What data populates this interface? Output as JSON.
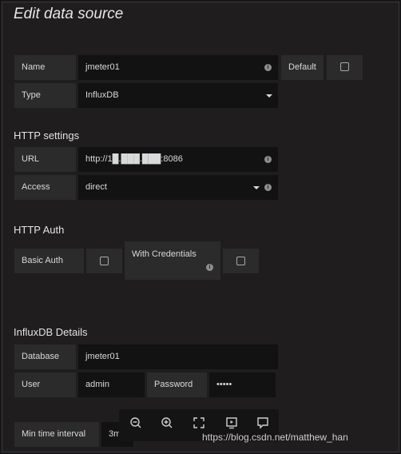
{
  "title": "Edit data source",
  "general": {
    "name_label": "Name",
    "name_value": "jmeter01",
    "default_label": "Default",
    "type_label": "Type",
    "type_value": "InfluxDB"
  },
  "http": {
    "heading": "HTTP settings",
    "url_label": "URL",
    "url_value": "http://1█.███.███:8086",
    "access_label": "Access",
    "access_value": "direct"
  },
  "auth": {
    "heading": "HTTP Auth",
    "basic_auth_label": "Basic Auth",
    "with_credentials_label": "With Credentials"
  },
  "influx": {
    "heading": "InfluxDB Details",
    "database_label": "Database",
    "database_value": "jmeter01",
    "user_label": "User",
    "user_value": "admin",
    "password_label": "Password",
    "password_value": "•••••"
  },
  "min_interval": {
    "label": "Min time interval",
    "value": "3m"
  },
  "toolbar": {
    "icons": [
      "zoom-out-icon",
      "zoom-in-icon",
      "fullscreen-icon",
      "slideshow-icon",
      "comment-icon"
    ]
  },
  "watermark": "https://blog.csdn.net/matthew_han"
}
